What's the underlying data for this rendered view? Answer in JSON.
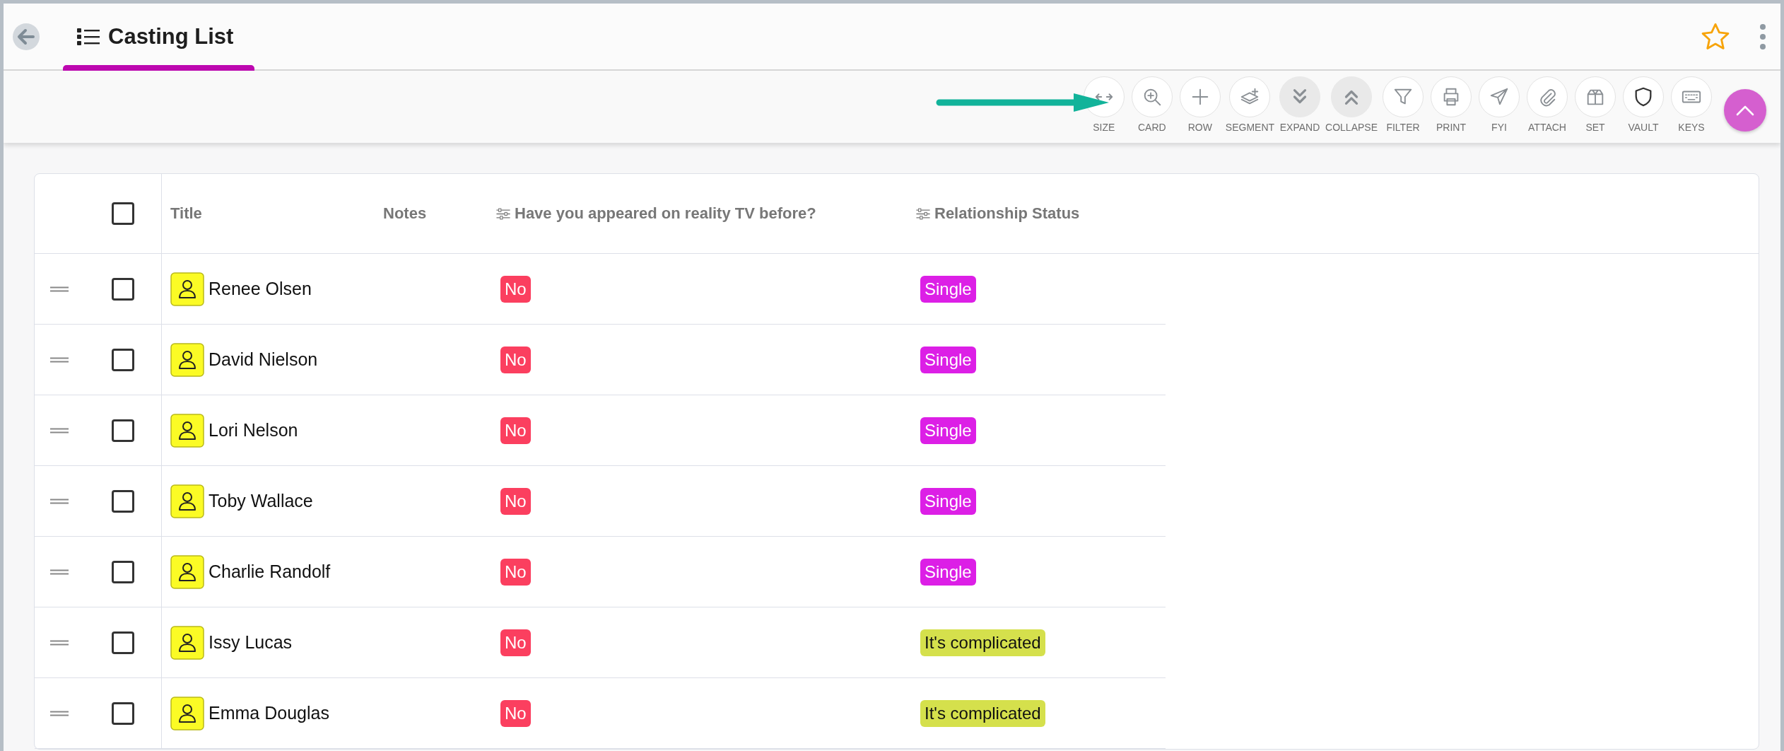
{
  "header": {
    "title": "Casting List"
  },
  "toolbar": [
    {
      "label": "SIZE",
      "kind": "size",
      "highlighted": false
    },
    {
      "label": "CARD",
      "kind": "zoom",
      "highlighted": false
    },
    {
      "label": "ROW",
      "kind": "plus",
      "highlighted": false
    },
    {
      "label": "SEGMENT",
      "kind": "layers",
      "highlighted": false
    },
    {
      "label": "EXPAND",
      "kind": "down",
      "highlighted": true
    },
    {
      "label": "COLLAPSE",
      "kind": "up",
      "highlighted": true
    },
    {
      "label": "FILTER",
      "kind": "funnel",
      "highlighted": false
    },
    {
      "label": "PRINT",
      "kind": "printer",
      "highlighted": false
    },
    {
      "label": "FYI",
      "kind": "plane",
      "highlighted": false
    },
    {
      "label": "ATTACH",
      "kind": "clip",
      "highlighted": false
    },
    {
      "label": "SET",
      "kind": "box",
      "highlighted": false
    },
    {
      "label": "VAULT",
      "kind": "shield",
      "highlighted": false
    },
    {
      "label": "KEYS",
      "kind": "keyboard",
      "highlighted": false
    }
  ],
  "table": {
    "select_all": {
      "checked": false
    },
    "columns": [
      {
        "label": "Title",
        "filter": false
      },
      {
        "label": "Notes",
        "filter": false
      },
      {
        "label": "Have you appeared on reality TV before?",
        "filter": true
      },
      {
        "label": "Relationship Status",
        "filter": true
      }
    ],
    "rows": [
      {
        "checked": false,
        "title": "Renee Olsen",
        "reality_tv": {
          "text": "No",
          "color": "#fb3f5f"
        },
        "status": {
          "text": "Single",
          "color": "#dc1fe6"
        }
      },
      {
        "checked": false,
        "title": "David Nielson",
        "reality_tv": {
          "text": "No",
          "color": "#fb3f5f"
        },
        "status": {
          "text": "Single",
          "color": "#dc1fe6"
        }
      },
      {
        "checked": false,
        "title": "Lori Nelson",
        "reality_tv": {
          "text": "No",
          "color": "#fb3f5f"
        },
        "status": {
          "text": "Single",
          "color": "#dc1fe6"
        }
      },
      {
        "checked": false,
        "title": "Toby Wallace",
        "reality_tv": {
          "text": "No",
          "color": "#fb3f5f"
        },
        "status": {
          "text": "Single",
          "color": "#dc1fe6"
        }
      },
      {
        "checked": false,
        "title": "Charlie Randolf",
        "reality_tv": {
          "text": "No",
          "color": "#fb3f5f"
        },
        "status": {
          "text": "Single",
          "color": "#dc1fe6"
        }
      },
      {
        "checked": false,
        "title": "Issy Lucas",
        "reality_tv": {
          "text": "No",
          "color": "#fb3f5f"
        },
        "status": {
          "text": "It's complicated",
          "color": "#d5e04c"
        }
      },
      {
        "checked": false,
        "title": "Emma Douglas",
        "reality_tv": {
          "text": "No",
          "color": "#fb3f5f"
        },
        "status": {
          "text": "It's complicated",
          "color": "#d5e04c"
        }
      }
    ]
  }
}
